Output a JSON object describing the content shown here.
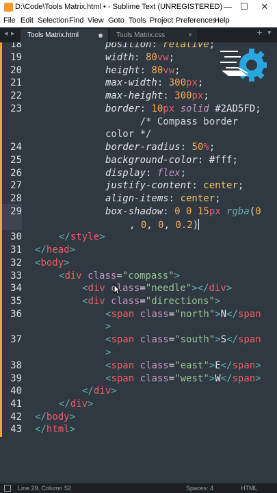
{
  "window": {
    "title": "D:\\Code\\Tools Matrix.html • - Sublime Text (UNREGISTERED)",
    "minimize": "—",
    "maximize": "☐",
    "close": "✕"
  },
  "menu": [
    "File",
    "Edit",
    "Selection",
    "Find",
    "View",
    "Goto",
    "Tools",
    "Project",
    "Preferences",
    "Help"
  ],
  "tabs": [
    {
      "label": "Tools Matrix.html",
      "active": true,
      "modified": true
    },
    {
      "label": "Tools Matrix.css",
      "active": false,
      "close": "×"
    }
  ],
  "tab_nav": {
    "add": "+",
    "more": "▾"
  },
  "gutter": [
    "18",
    "19",
    "20",
    "21",
    "22",
    "23",
    "24",
    "25",
    "26",
    "27",
    "28",
    "29",
    "30",
    "31",
    "32",
    "33",
    "34",
    "35",
    "36",
    "37",
    "38",
    "39",
    "40",
    "41",
    "42",
    "43"
  ],
  "code": {
    "l18": {
      "prop": "position",
      "val": "relative"
    },
    "l19": {
      "prop": "width",
      "num": "80",
      "unit": "vw"
    },
    "l20": {
      "prop": "height",
      "num": "80",
      "unit": "vw"
    },
    "l21": {
      "prop": "max-width",
      "num": "300",
      "unit": "px"
    },
    "l22": {
      "prop": "max-height",
      "num": "300",
      "unit": "px"
    },
    "l23": {
      "prop": "border",
      "num": "10",
      "unit": "px",
      "kw": "solid",
      "color": "#2AD5FD",
      "comment1": "/* Compass border",
      "comment2": "color */"
    },
    "l24": {
      "prop": "border-radius",
      "num": "50",
      "unit": "%"
    },
    "l25": {
      "prop": "background-color",
      "color": "#fff"
    },
    "l26": {
      "prop": "display",
      "kw": "flex"
    },
    "l27": {
      "prop": "justify-content",
      "val": "center"
    },
    "l28": {
      "prop": "align-items",
      "val": "center"
    },
    "l29": {
      "prop": "box-shadow",
      "a": "0",
      "b": "0",
      "c": "15",
      "unit": "px",
      "fn": "rgba",
      "r": "0",
      "g": "0",
      "bl": "0",
      "alpha": "0.2"
    },
    "l30": {
      "tag": "style"
    },
    "l31": {
      "tag": "head"
    },
    "l32": {
      "tag": "body"
    },
    "l33": {
      "tag": "div",
      "attr": "class",
      "str": "\"compass\""
    },
    "l34": {
      "tag": "div",
      "attr": "class",
      "str": "\"needle\"",
      "close": "div"
    },
    "l35": {
      "tag": "div",
      "attr": "class",
      "str": "\"directions\""
    },
    "l36": {
      "tag": "span",
      "attr": "class",
      "str": "\"north\"",
      "text": "N",
      "close": "span"
    },
    "l37": {
      "tag": "span",
      "attr": "class",
      "str": "\"south\"",
      "text": "S",
      "close": "span"
    },
    "l38": {
      "tag": "span",
      "attr": "class",
      "str": "\"east\"",
      "text": "E",
      "close": "span"
    },
    "l39": {
      "tag": "span",
      "attr": "class",
      "str": "\"west\"",
      "text": "W",
      "close": "span"
    },
    "l40": {
      "tag": "div"
    },
    "l41": {
      "tag": "div"
    },
    "l42": {
      "tag": "body"
    },
    "l43": {
      "tag": "html"
    }
  },
  "status": {
    "position": "Line 29, Column 52",
    "spaces": "Spaces: 4",
    "syntax": "HTML"
  },
  "colors": {
    "accent": "#f0a33a",
    "logo": "#2aa7e0",
    "background": "#303841"
  }
}
